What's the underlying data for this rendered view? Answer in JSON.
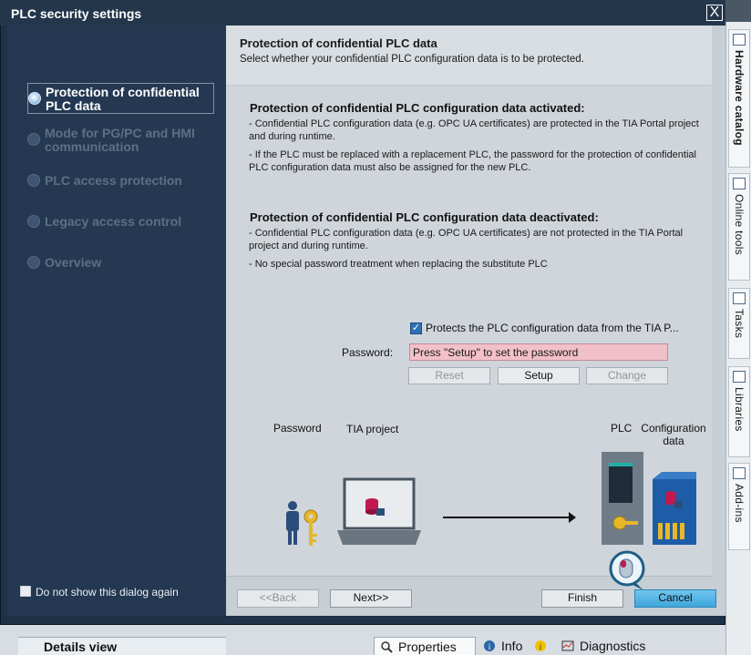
{
  "dialog": {
    "title": "PLC security settings",
    "close_label": "X"
  },
  "nav": {
    "items": [
      {
        "label": "Protection of confidential PLC data",
        "active": true
      },
      {
        "label": "Mode for PG/PC and HMI communication",
        "active": false
      },
      {
        "label": "PLC access protection",
        "active": false
      },
      {
        "label": "Legacy access control",
        "active": false
      },
      {
        "label": "Overview",
        "active": false
      }
    ],
    "dont_show_label": "Do not show this dialog again"
  },
  "header": {
    "title": "Protection of confidential PLC data",
    "subtitle": "Select whether your confidential PLC configuration data is to be protected."
  },
  "sections": {
    "activated": {
      "title": "Protection of confidential PLC configuration data activated:",
      "lines": [
        "- Confidential PLC configuration data (e.g. OPC UA certificates) are protected in the TIA Portal project and during runtime.",
        "- If the PLC must be replaced with a replacement PLC, the password for the protection of confidential PLC configuration data must also be assigned for the new PLC."
      ]
    },
    "deactivated": {
      "title": "Protection of confidential PLC configuration data deactivated:",
      "lines": [
        "- Confidential PLC configuration data (e.g. OPC UA certificates) are not protected in the TIA Portal project and during runtime.",
        "- No special password treatment when replacing the substitute PLC"
      ]
    }
  },
  "protection": {
    "checkbox_label": "Protects the PLC configuration data from the TIA P...",
    "checked": true,
    "password_label": "Password:",
    "password_value": "Press \"Setup\" to set the password",
    "buttons": {
      "reset": "Reset",
      "setup": "Setup",
      "change": "Change"
    }
  },
  "illustration": {
    "password_label": "Password",
    "tia_project_label": "TIA project",
    "plc_label": "PLC",
    "config_data_label": "Configuration data"
  },
  "footer": {
    "back": "<<Back",
    "next": "Next>>",
    "finish": "Finish",
    "cancel": "Cancel"
  },
  "rail": {
    "tabs": [
      "Hardware catalog",
      "Online tools",
      "Tasks",
      "Libraries",
      "Add-ins"
    ]
  },
  "host": {
    "details_view": "Details view",
    "properties": "Properties",
    "info": "Info",
    "diagnostics": "Diagnostics"
  },
  "colors": {
    "dialog_bg": "#1f3147",
    "content_bg": "#cfd5da",
    "password_field": "#f2c0c9",
    "accent": "#3fa6dc"
  }
}
